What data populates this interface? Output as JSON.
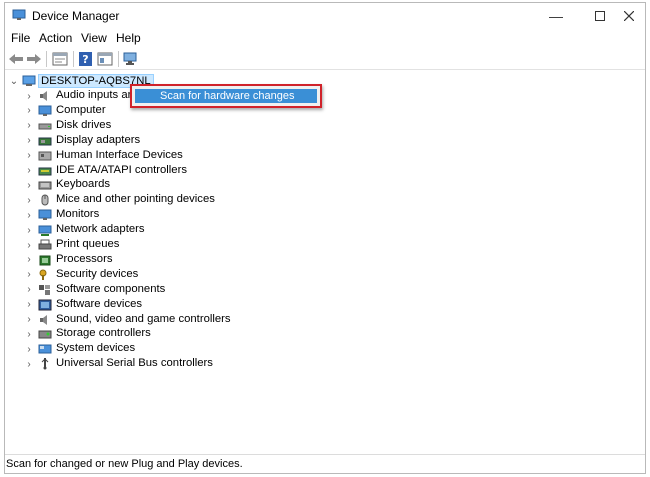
{
  "window": {
    "title": "Device Manager"
  },
  "menu": [
    "File",
    "Action",
    "View",
    "Help"
  ],
  "tree": {
    "root": "DESKTOP-AQBS7NL",
    "items": [
      {
        "label": "Audio inputs an",
        "icon": "speaker-icon"
      },
      {
        "label": "Computer",
        "icon": "monitor-icon"
      },
      {
        "label": "Disk drives",
        "icon": "disk-icon"
      },
      {
        "label": "Display adapters",
        "icon": "display-adapter-icon"
      },
      {
        "label": "Human Interface Devices",
        "icon": "hid-icon"
      },
      {
        "label": "IDE ATA/ATAPI controllers",
        "icon": "ide-controller-icon"
      },
      {
        "label": "Keyboards",
        "icon": "keyboard-icon"
      },
      {
        "label": "Mice and other pointing devices",
        "icon": "mouse-icon"
      },
      {
        "label": "Monitors",
        "icon": "monitor-icon"
      },
      {
        "label": "Network adapters",
        "icon": "network-icon"
      },
      {
        "label": "Print queues",
        "icon": "printer-icon"
      },
      {
        "label": "Processors",
        "icon": "processor-icon"
      },
      {
        "label": "Security devices",
        "icon": "security-key-icon"
      },
      {
        "label": "Software components",
        "icon": "software-component-icon"
      },
      {
        "label": "Software devices",
        "icon": "software-device-icon"
      },
      {
        "label": "Sound, video and game controllers",
        "icon": "speaker-icon"
      },
      {
        "label": "Storage controllers",
        "icon": "storage-controller-icon"
      },
      {
        "label": "System devices",
        "icon": "system-device-icon"
      },
      {
        "label": "Universal Serial Bus controllers",
        "icon": "usb-icon"
      }
    ]
  },
  "context_menu": {
    "item": "Scan for hardware changes"
  },
  "status": "Scan for changed or new Plug and Play devices."
}
